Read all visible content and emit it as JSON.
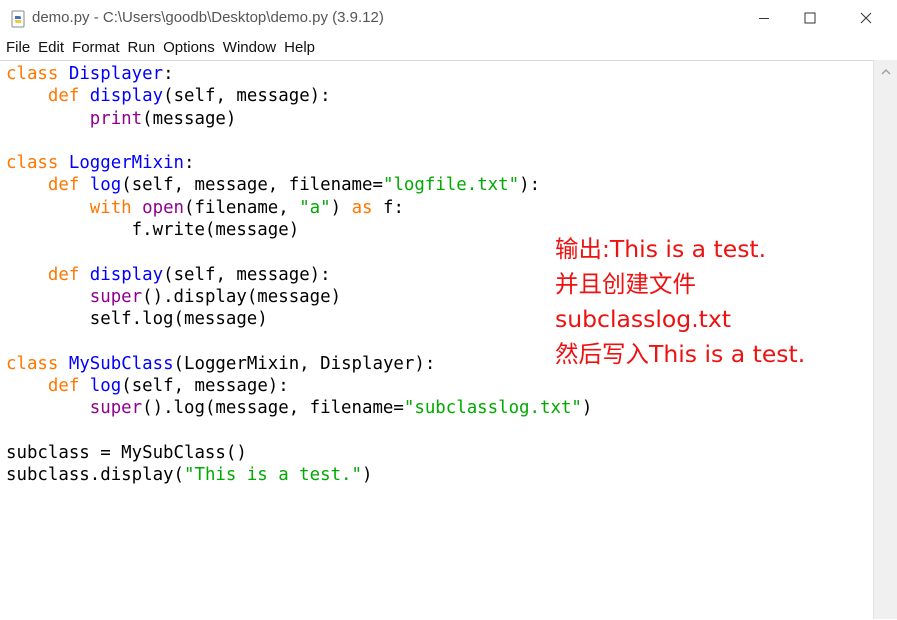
{
  "window": {
    "title": "demo.py - C:\\Users\\goodb\\Desktop\\demo.py (3.9.12)",
    "icon": "python-file-icon"
  },
  "menu": {
    "items": [
      "File",
      "Edit",
      "Format",
      "Run",
      "Options",
      "Window",
      "Help"
    ]
  },
  "code": {
    "lines": [
      [
        {
          "t": "class",
          "c": "kw"
        },
        {
          "t": " "
        },
        {
          "t": "Displayer",
          "c": "def"
        },
        {
          "t": ":"
        }
      ],
      [
        {
          "t": "    "
        },
        {
          "t": "def",
          "c": "kw"
        },
        {
          "t": " "
        },
        {
          "t": "display",
          "c": "def"
        },
        {
          "t": "(self, message):"
        }
      ],
      [
        {
          "t": "        "
        },
        {
          "t": "print",
          "c": "bi"
        },
        {
          "t": "(message)"
        }
      ],
      [],
      [
        {
          "t": "class",
          "c": "kw"
        },
        {
          "t": " "
        },
        {
          "t": "LoggerMixin",
          "c": "def"
        },
        {
          "t": ":"
        }
      ],
      [
        {
          "t": "    "
        },
        {
          "t": "def",
          "c": "kw"
        },
        {
          "t": " "
        },
        {
          "t": "log",
          "c": "def"
        },
        {
          "t": "(self, message, filename="
        },
        {
          "t": "\"logfile.txt\"",
          "c": "str"
        },
        {
          "t": "):"
        }
      ],
      [
        {
          "t": "        "
        },
        {
          "t": "with",
          "c": "kw"
        },
        {
          "t": " "
        },
        {
          "t": "open",
          "c": "bi"
        },
        {
          "t": "(filename, "
        },
        {
          "t": "\"a\"",
          "c": "str"
        },
        {
          "t": ") "
        },
        {
          "t": "as",
          "c": "kw"
        },
        {
          "t": " f:"
        }
      ],
      [
        {
          "t": "            f.write(message)"
        }
      ],
      [],
      [
        {
          "t": "    "
        },
        {
          "t": "def",
          "c": "kw"
        },
        {
          "t": " "
        },
        {
          "t": "display",
          "c": "def"
        },
        {
          "t": "(self, message):"
        }
      ],
      [
        {
          "t": "        "
        },
        {
          "t": "super",
          "c": "bi"
        },
        {
          "t": "().display(message)"
        }
      ],
      [
        {
          "t": "        self.log(message)"
        }
      ],
      [],
      [
        {
          "t": "class",
          "c": "kw"
        },
        {
          "t": " "
        },
        {
          "t": "MySubClass",
          "c": "def"
        },
        {
          "t": "(LoggerMixin, Displayer):"
        }
      ],
      [
        {
          "t": "    "
        },
        {
          "t": "def",
          "c": "kw"
        },
        {
          "t": " "
        },
        {
          "t": "log",
          "c": "def"
        },
        {
          "t": "(self, message):"
        }
      ],
      [
        {
          "t": "        "
        },
        {
          "t": "super",
          "c": "bi"
        },
        {
          "t": "().log(message, filename="
        },
        {
          "t": "\"subclasslog.txt\"",
          "c": "str"
        },
        {
          "t": ")"
        }
      ],
      [],
      [
        {
          "t": "subclass = MySubClass()"
        }
      ],
      [
        {
          "t": "subclass.display("
        },
        {
          "t": "\"This is a test.\"",
          "c": "str"
        },
        {
          "t": ")"
        }
      ]
    ]
  },
  "annotation": {
    "lines": [
      "输出:This is a test.",
      "并且创建文件",
      "subclasslog.txt",
      "然后写入This is a test."
    ],
    "color": "#ee1111"
  },
  "colors": {
    "keyword": "#ff7700",
    "definition": "#0000ff",
    "builtin": "#900090",
    "string": "#00aa00"
  }
}
